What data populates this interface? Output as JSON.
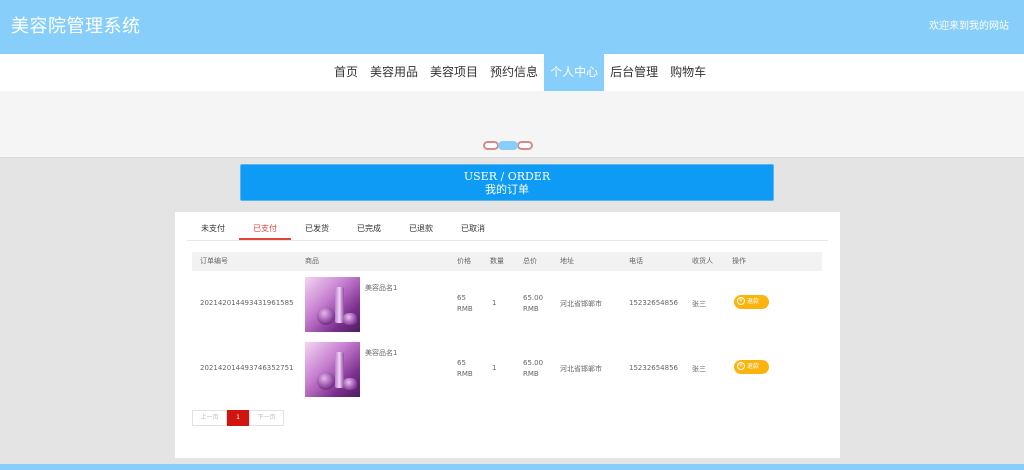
{
  "header": {
    "title": "美容院管理系统",
    "welcome": "欢迎来到我的网站"
  },
  "nav": {
    "items": [
      "首页",
      "美容用品",
      "美容项目",
      "预约信息",
      "个人中心",
      "后台管理",
      "购物车"
    ],
    "active_index": 4
  },
  "order_header": {
    "en": "USER / ORDER",
    "cn": "我的订单"
  },
  "tabs": {
    "items": [
      "未支付",
      "已支付",
      "已发货",
      "已完成",
      "已退款",
      "已取消"
    ],
    "active_index": 1
  },
  "table": {
    "columns": [
      "订单编号",
      "商品",
      "价格",
      "数量",
      "总价",
      "地址",
      "电话",
      "收货人",
      "操作"
    ],
    "rows": [
      {
        "order_no": "2021420144934319615​85",
        "product": "美容品名1",
        "price": "65",
        "price_unit": "RMB",
        "qty": "1",
        "total": "65.00",
        "total_unit": "RMB",
        "address": "河北省邯郸市",
        "phone": "15232654856",
        "receiver": "张三",
        "action": "退款"
      },
      {
        "order_no": "202142014493746352751",
        "product": "美容品名1",
        "price": "65",
        "price_unit": "RMB",
        "qty": "1",
        "total": "65.00",
        "total_unit": "RMB",
        "address": "河北省邯郸市",
        "phone": "15232654856",
        "receiver": "张三",
        "action": "退款"
      }
    ]
  },
  "pager": {
    "prev": "上一页",
    "current": "1",
    "next": "下一页"
  },
  "colors": {
    "topbar": "#87cefa",
    "accent_blue": "#0d9bf6",
    "tab_active": "#e0443a",
    "refund": "#fbb40d",
    "page_current": "#d0140f"
  },
  "icons": {
    "refund": "yen-circle-icon"
  }
}
